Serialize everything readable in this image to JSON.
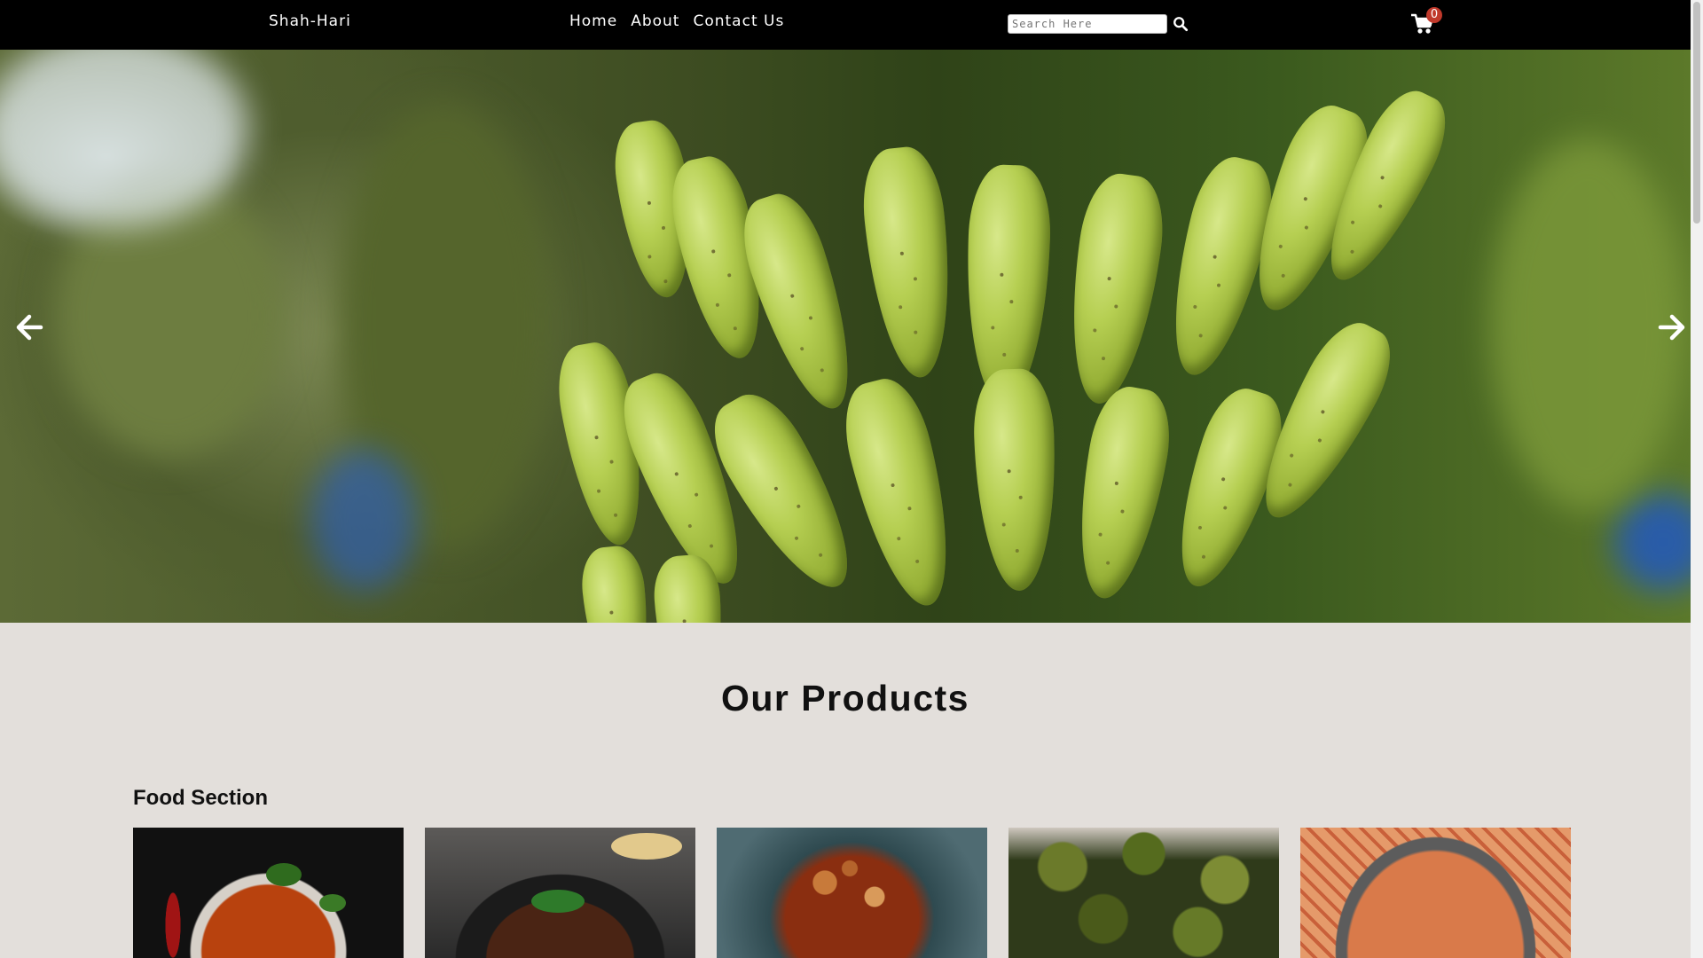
{
  "navbar": {
    "brand": "Shah-Hari",
    "links": [
      "Home",
      "About",
      "Contact Us"
    ],
    "search": {
      "placeholder": "Search Here",
      "value": ""
    },
    "cart_count": "0"
  },
  "hero": {
    "prev_icon": "arrow-left-icon",
    "next_icon": "arrow-right-icon"
  },
  "products": {
    "title": "Our Products",
    "food_section": "Food Section",
    "cards": [
      {
        "image": "curry-bowl"
      },
      {
        "image": "meat-pan"
      },
      {
        "image": "stew-pot"
      },
      {
        "image": "bitter-gourd"
      },
      {
        "image": "pasta"
      }
    ]
  },
  "colors": {
    "navbar": "#000000",
    "page_bg": "#e3dfdb",
    "badge": "#c0392b"
  }
}
